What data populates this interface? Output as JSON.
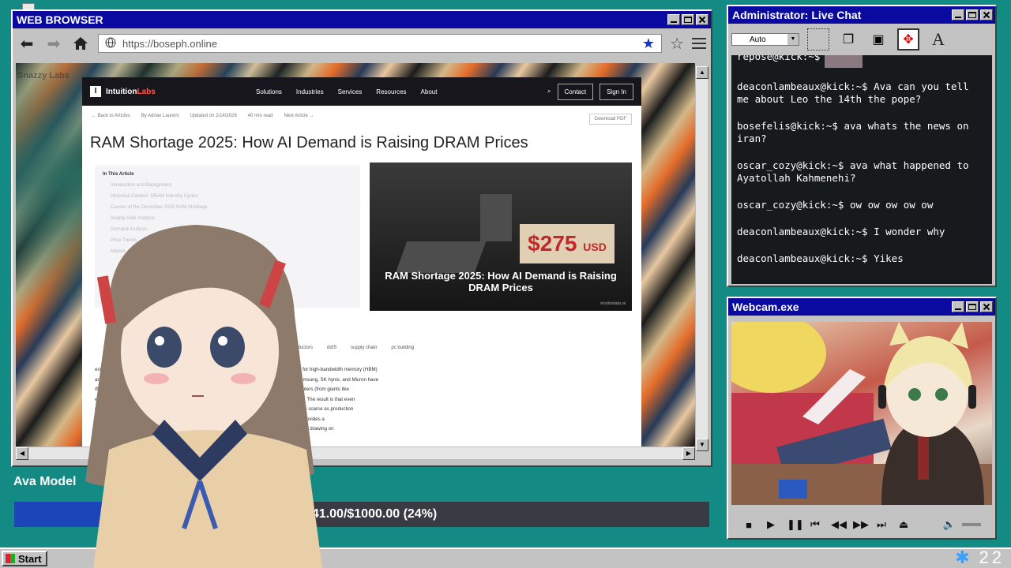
{
  "browser": {
    "title": "WEB BROWSER",
    "url": "https://boseph.online",
    "page": {
      "watermark": "Snazzy Labs",
      "site_logo_prefix": "Intuition",
      "site_logo_suffix": "Labs",
      "nav": [
        "Solutions",
        "Industries",
        "Services",
        "Resources",
        "About"
      ],
      "contact": "Contact",
      "signin": "Sign In",
      "crumbs": [
        "← Back to Articles",
        "By Adrian Laurent",
        "Updated on 2/14/2026",
        "40 min read",
        "Next Article →"
      ],
      "download": "Download PDF",
      "title": "RAM Shortage 2025: How AI Demand is Raising DRAM Prices",
      "toc_heading": "In This Article",
      "toc_items": [
        "Introduction and Background",
        "Historical Context: DRAM Industry Cycles",
        "Causes of the December 2025 RAM Shortage",
        "Supply-Side Analysis",
        "Demand Analysis",
        "Price Trends",
        "Market"
      ],
      "hero_price": "$275",
      "hero_currency": "USD",
      "hero_title": "RAM Shortage 2025: How AI Demand is Raising DRAM Prices",
      "hero_site": "intuitionlabs.ai",
      "tags": [
        "semiconductors",
        "ddr5",
        "supply chain",
        "pc building"
      ],
      "body_lines": [
        "ecuti                                                                                     g with an unprecedented RAM (DRAM) shortage. Exponentially rising demand - especially for high-bandwidth memory (HBM)",
        "and next                                                                                  traints leading to record-high prices and supply rationing. Major industry players like Samsung, SK hynix, and Micron have",
        "ifted c                                                                                    anced LPDDR), deliberately holding back commodity DRAM expansions (²) (³). AI data centers (from giants like",
        "                                                                                           effectively outbidding consumer PC, gaming, and smartphone markets for available DRAM. (²) (³). The result is that even",
        "odbit                                                                                      16Gb DDR5 chip prices rose from ~$6.84 to ~$27.20 in Q4 2025 (²) (³), and bargain DDR4 is scarce as production",
        "                                                                                           supply could persist into 2027–2028 when new fabrication plants come online (²) (³). This report provides a",
        "                                                                                           omic causes, industry responses, effects on various sectors, and foreseeable future developments, drawing on"
      ]
    }
  },
  "model_widget": {
    "label": "Ava Model",
    "progress_text": "241.00/$1000.00 (24%)",
    "progress_fraction": 0.24
  },
  "chat": {
    "title": "Administrator: Live Chat",
    "font_select": "Auto",
    "messages": [
      {
        "user": "repose@kick:~$",
        "text": ""
      },
      {
        "user": "deaconlambeaux@kick:~$",
        "text": "Ava can you tell me about Leo the 14th the pope?"
      },
      {
        "user": "bosefelis@kick:~$",
        "text": "ava whats the news on iran?"
      },
      {
        "user": "oscar_cozy@kick:~$",
        "text": "ava what happened to Ayatollah Kahmenehi?"
      },
      {
        "user": "oscar_cozy@kick:~$",
        "text": "ow ow ow ow ow"
      },
      {
        "user": "deaconlambeaux@kick:~$",
        "text": "I wonder why"
      },
      {
        "user": "deaconlambeaux@kick:~$",
        "text": "Yikes"
      }
    ]
  },
  "webcam": {
    "title": "Webcam.exe"
  },
  "taskbar": {
    "start": "Start",
    "clock": "22"
  },
  "colors": {
    "desktop": "#138a84",
    "titlebar": "#0a0aa0",
    "progress_fill": "#1c46b8"
  }
}
